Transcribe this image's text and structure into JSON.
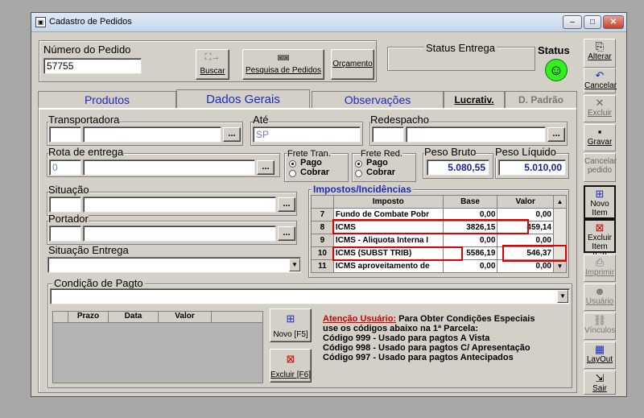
{
  "window": {
    "title": "Cadastro de Pedidos",
    "min": "‒",
    "max": "□",
    "close": "✕"
  },
  "header": {
    "numero_label": "Número do Pedido",
    "numero_value": "57755",
    "buscar": "Buscar",
    "pesquisa": "Pesquisa de Pedidos",
    "orcamento": "Orçamento",
    "status_entrega_label": "Status Entrega",
    "status_label": "Status"
  },
  "tabs": [
    "Produtos",
    "Dados Gerais",
    "Observações",
    "Lucrativ.",
    "D. Padrão"
  ],
  "side": {
    "alterar": "Alterar",
    "cancelar": "Cancelar",
    "excluir": "Excluir",
    "gravar": "Gravar",
    "cancelar_pedido": "Cancelar pedido",
    "novo_item": "Novo Item [F2]",
    "excluir_item": "Excluir Item [F3]",
    "imprimir": "Imprimir",
    "usuario": "Usuário",
    "vinculos": "Vínculos",
    "layout": "LayOut",
    "sair": "Sair"
  },
  "form": {
    "transportadora": "Transportadora",
    "ate": "Até",
    "ate_value": "SP",
    "redespacho": "Redespacho",
    "rota": "Rota de entrega",
    "rota_value": "0",
    "frete_tran": "Frete Tran.",
    "frete_red": "Frete Red.",
    "pago": "Pago",
    "cobrar": "Cobrar",
    "peso_bruto": "Peso Bruto",
    "peso_bruto_value": "5.080,55",
    "peso_liquido": "Peso Líquido",
    "peso_liquido_value": "5.010,00",
    "situacao": "Situação",
    "portador": "Portador",
    "situacao_entrega": "Situação Entrega",
    "condicao": "Condição de Pagto",
    "dots": "..."
  },
  "impostos": {
    "title": "Impostos/Incidências",
    "headers": [
      "Imposto",
      "Base",
      "Valor"
    ],
    "rows": [
      {
        "n": "7",
        "imposto": "Fundo de Combate Pobr",
        "base": "0,00",
        "valor": "0,00"
      },
      {
        "n": "8",
        "imposto": "ICMS",
        "base": "3826,15",
        "valor": "459,14"
      },
      {
        "n": "9",
        "imposto": "ICMS - Aliquota Interna I",
        "base": "0,00",
        "valor": "0,00"
      },
      {
        "n": "10",
        "imposto": "ICMS (SUBST TRIB)",
        "base": "5586,19",
        "valor": "546,37"
      },
      {
        "n": "11",
        "imposto": "ICMS aproveitamento de",
        "base": "0,00",
        "valor": "0,00"
      }
    ]
  },
  "parcelas": {
    "headers": [
      "Prazo",
      "Data",
      "Valor"
    ],
    "novo": "Novo [F5]",
    "excluir": "Excluir [F6]"
  },
  "aviso": {
    "titulo": "Atenção Usuário:",
    "l1": "Para Obter Condições Especiais",
    "l2": "use os códigos abaixo na 1ª Parcela:",
    "l3": "Código 999 - Usado para pagtos A Vista",
    "l4": "Código 998 - Usado para pagtos C/ Apresentação",
    "l5": "Código 997 - Usado para pagtos Antecipados"
  }
}
